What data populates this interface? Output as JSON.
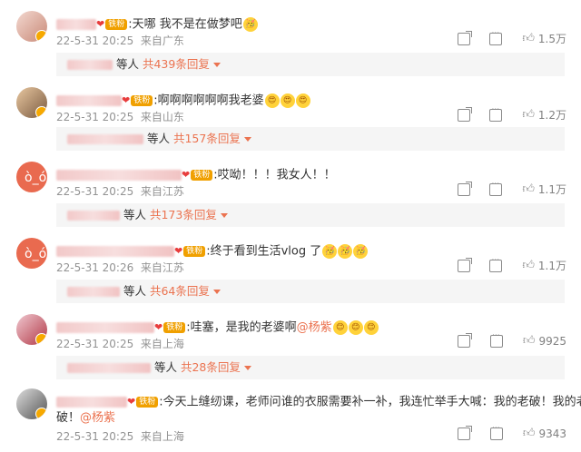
{
  "comments": [
    {
      "text": ":天哪 我不是在做梦吧",
      "emojis": [
        "🥳"
      ],
      "time": "22-5-31 20:25",
      "location": "来自广东",
      "likes": "1.5万",
      "reply_who": "等人",
      "reply_count": "共439条回复"
    },
    {
      "text": ":啊啊啊啊啊啊我老婆",
      "emojis": [
        "😍",
        "😍",
        "😍"
      ],
      "time": "22-5-31 20:25",
      "location": "来自山东",
      "likes": "1.2万",
      "reply_who": "等人",
      "reply_count": "共157条回复"
    },
    {
      "text": ":哎呦！！！我女人！！",
      "emojis": [],
      "time": "22-5-31 20:25",
      "location": "来自江苏",
      "likes": "1.1万",
      "reply_who": "等人",
      "reply_count": "共173条回复"
    },
    {
      "text": ":终于看到生活vlog 了",
      "emojis": [
        "🥳",
        "🥳",
        "🥳"
      ],
      "time": "22-5-31 20:26",
      "location": "来自江苏",
      "likes": "1.1万",
      "reply_who": "等人",
      "reply_count": "共64条回复"
    },
    {
      "text": ":哇塞，是我的老婆啊",
      "mention": "@杨紫",
      "emojis": [
        "😊",
        "😊",
        "😊"
      ],
      "time": "22-5-31 20:25",
      "location": "来自上海",
      "likes": "9925",
      "reply_who": "等人",
      "reply_count": "共28条回复"
    },
    {
      "text": ":今天上缝纫课，老师问谁的衣服需要补一补，我连忙举手大喊：我的老破！我的老",
      "text2": "破！",
      "mention": "@杨紫",
      "emojis": [],
      "time": "22-5-31 20:25",
      "location": "来自上海",
      "likes": "9343"
    }
  ],
  "badge": {
    "fan_label": "铁粉"
  },
  "colors": {
    "accent": "#eb7350",
    "meta": "#939393",
    "badge": "#f0a000"
  },
  "icons": [
    "share-icon",
    "comment-icon",
    "like-icon"
  ]
}
